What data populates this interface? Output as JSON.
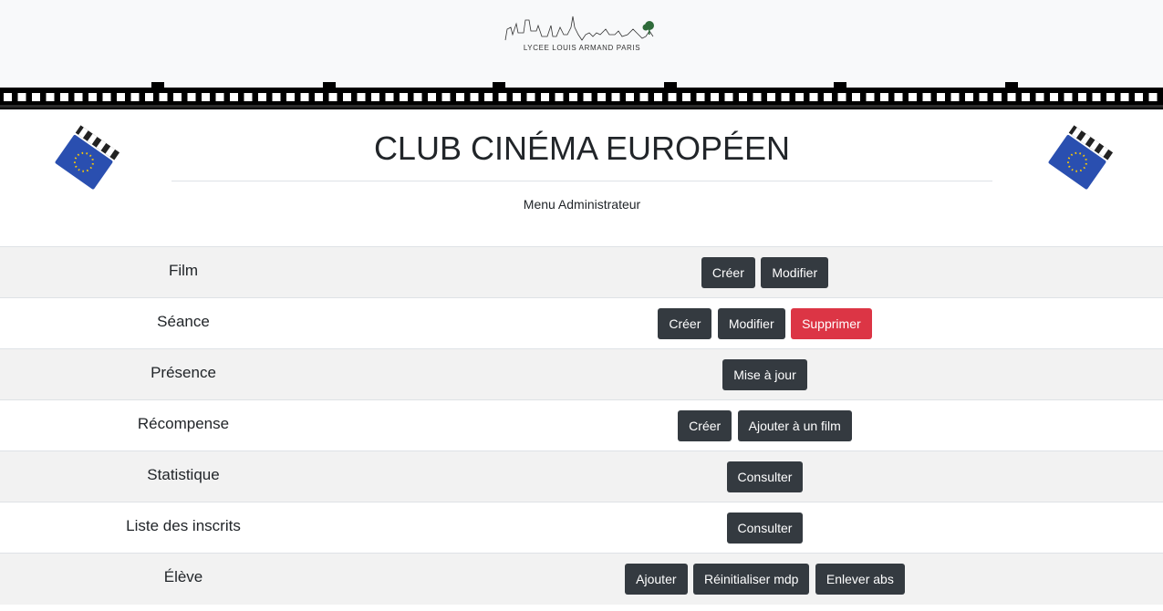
{
  "header": {
    "logo_text": "LYCEE LOUIS ARMAND PARIS"
  },
  "page": {
    "title": "CLUB CINÉMA EUROPÉEN",
    "subtitle": "Menu Administrateur"
  },
  "menu": [
    {
      "label": "Film",
      "buttons": [
        "Créer",
        "Modifier"
      ]
    },
    {
      "label": "Séance",
      "buttons": [
        "Créer",
        "Modifier",
        "Supprimer"
      ]
    },
    {
      "label": "Présence",
      "buttons": [
        "Mise à jour"
      ]
    },
    {
      "label": "Récompense",
      "buttons": [
        "Créer",
        "Ajouter à un film"
      ]
    },
    {
      "label": "Statistique",
      "buttons": [
        "Consulter"
      ]
    },
    {
      "label": "Liste des inscrits",
      "buttons": [
        "Consulter"
      ]
    },
    {
      "label": "Élève",
      "buttons": [
        "Ajouter",
        "Réinitialiser mdp",
        "Enlever abs"
      ]
    }
  ],
  "colors": {
    "button_dark": "#343a40",
    "button_danger": "#dc3545",
    "header_bg": "#f8f9fa",
    "row_stripe": "#f2f2f2",
    "eu_blue": "#2a4fb0",
    "eu_star": "#ffcc00"
  },
  "icons": {
    "logo": "paris-skyline-logo",
    "clapperboard": "eu-clapperboard-icon",
    "filmstrip": "filmstrip-banner"
  }
}
